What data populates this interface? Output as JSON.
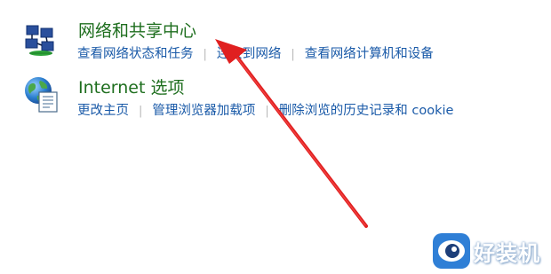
{
  "items": [
    {
      "icon": "network-sharing-center-icon",
      "title": "网络和共享中心",
      "links": [
        "查看网络状态和任务",
        "连接到网络",
        "查看网络计算机和设备"
      ]
    },
    {
      "icon": "internet-options-icon",
      "title": "Internet 选项",
      "links": [
        "更改主页",
        "管理浏览器加载项",
        "删除浏览的历史记录和 cookie"
      ]
    }
  ],
  "watermark": {
    "text": "好装机",
    "icon": "eye-logo-icon"
  },
  "colors": {
    "title": "#1e6e1e",
    "link": "#1a5aa8",
    "arrow": "#e02020",
    "background": "#ffffff"
  }
}
